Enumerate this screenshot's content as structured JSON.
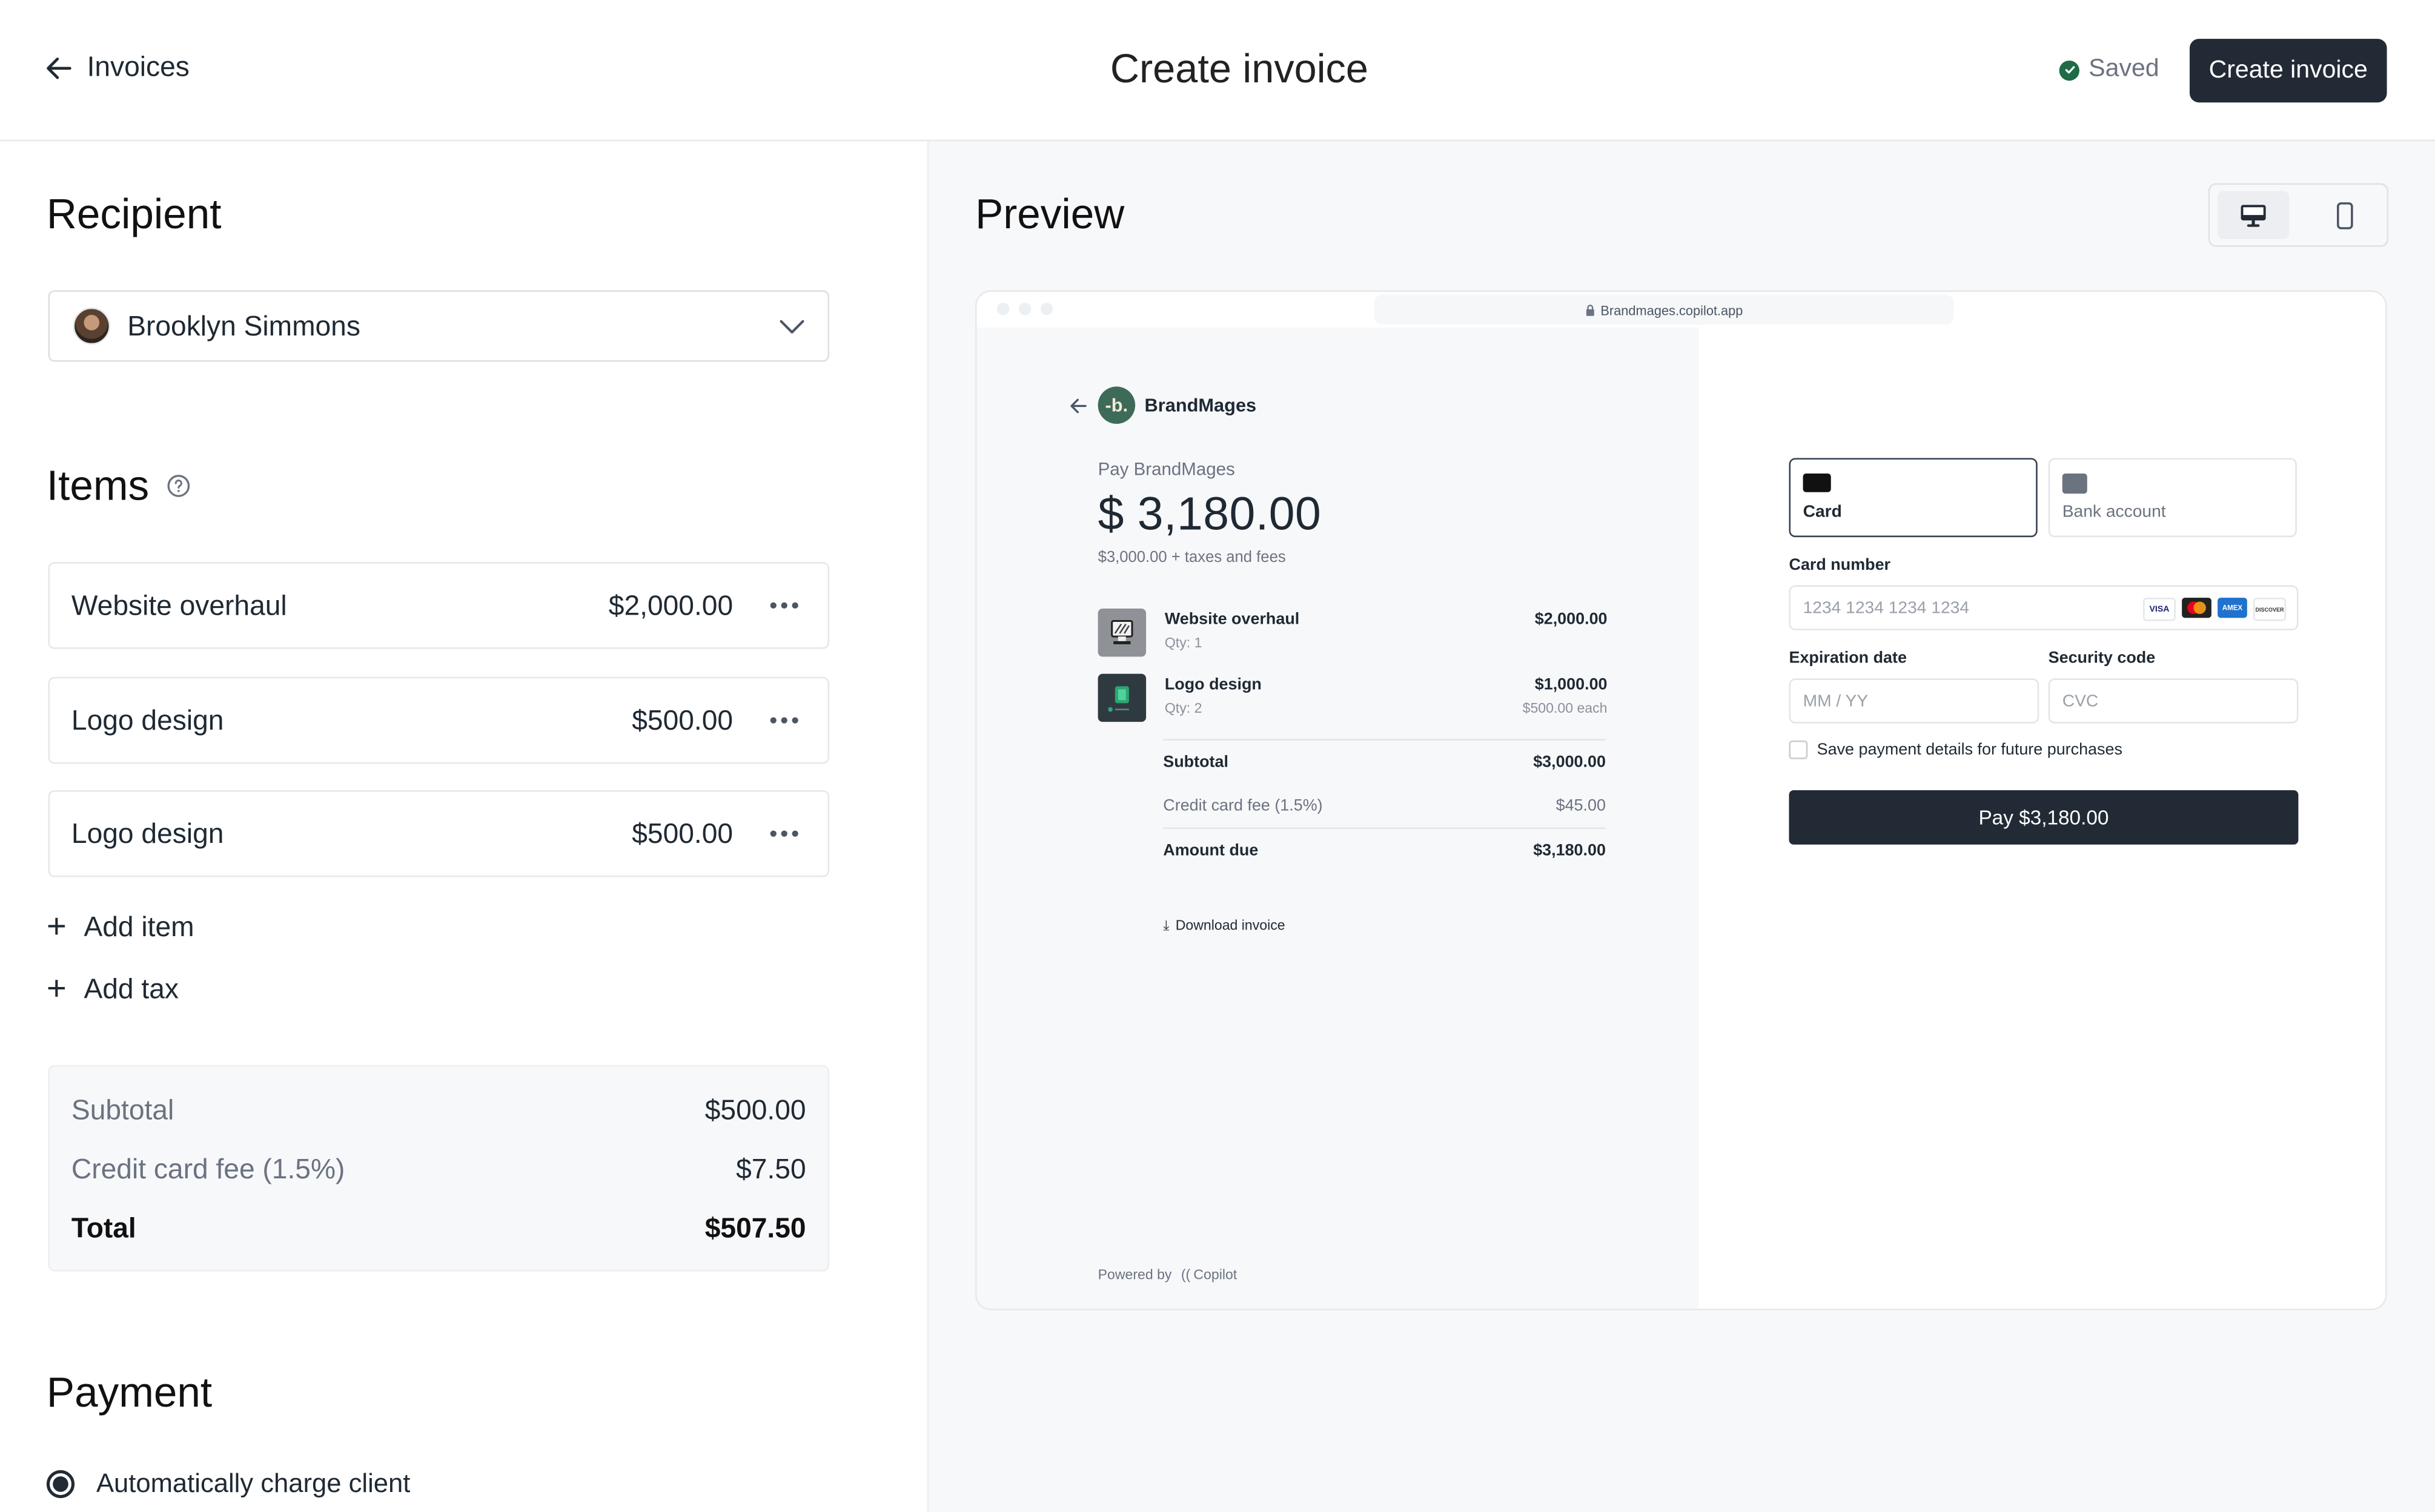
{
  "header": {
    "back_label": "Invoices",
    "title": "Create invoice",
    "saved_label": "Saved",
    "create_button": "Create invoice"
  },
  "recipient": {
    "heading": "Recipient",
    "selected": "Brooklyn Simmons"
  },
  "items": {
    "heading": "Items",
    "rows": [
      {
        "name": "Website overhaul",
        "price": "$2,000.00"
      },
      {
        "name": "Logo design",
        "price": "$500.00"
      },
      {
        "name": "Logo design",
        "price": "$500.00"
      }
    ],
    "add_item": "Add item",
    "add_tax": "Add tax"
  },
  "summary": {
    "subtotal_label": "Subtotal",
    "subtotal": "$500.00",
    "fee_label": "Credit card fee (1.5%)",
    "fee": "$7.50",
    "total_label": "Total",
    "total": "$507.50"
  },
  "payment": {
    "heading": "Payment",
    "option": "Automatically charge client",
    "option_selected": true
  },
  "preview": {
    "heading": "Preview",
    "view_modes": [
      {
        "name": "desktop",
        "icon": "monitor-icon",
        "active": true
      },
      {
        "name": "mobile",
        "icon": "phone-icon",
        "active": false
      }
    ],
    "url": "Brandmages.copilot.app",
    "brand": "BrandMages",
    "brand_initial": "-b.",
    "pay_to": "Pay BrandMages",
    "amount": "$ 3,180.00",
    "amount_note": "$3,000.00 + taxes and fees",
    "items": [
      {
        "name": "Website overhaul",
        "qty": "Qty: 1",
        "price": "$2,000.00",
        "each": ""
      },
      {
        "name": "Logo design",
        "qty": "Qty: 2",
        "price": "$1,000.00",
        "each": "$500.00 each"
      }
    ],
    "subtotal_label": "Subtotal",
    "subtotal": "$3,000.00",
    "fee_label": "Credit card fee (1.5%)",
    "fee": "$45.00",
    "due_label": "Amount due",
    "due": "$3,180.00",
    "download": "Download invoice",
    "powered_by": "Powered by",
    "powered_brand": "Copilot",
    "methods": [
      {
        "label": "Card",
        "selected": true
      },
      {
        "label": "Bank account",
        "selected": false
      }
    ],
    "card_number_label": "Card number",
    "card_number_placeholder": "1234 1234 1234 1234",
    "card_brands": [
      "VISA",
      "Mastercard",
      "AMEX",
      "DISCOVER"
    ],
    "exp_label": "Expiration date",
    "exp_placeholder": "MM / YY",
    "cvc_label": "Security code",
    "cvc_placeholder": "CVC",
    "save_details": "Save payment details for future purchases",
    "pay_button": "Pay $3,180.00"
  },
  "colors": {
    "primary": "#222b35",
    "saved_green": "#1e6b46",
    "brand_green": "#3d6b58",
    "panel_bg": "#f7f8fa"
  }
}
